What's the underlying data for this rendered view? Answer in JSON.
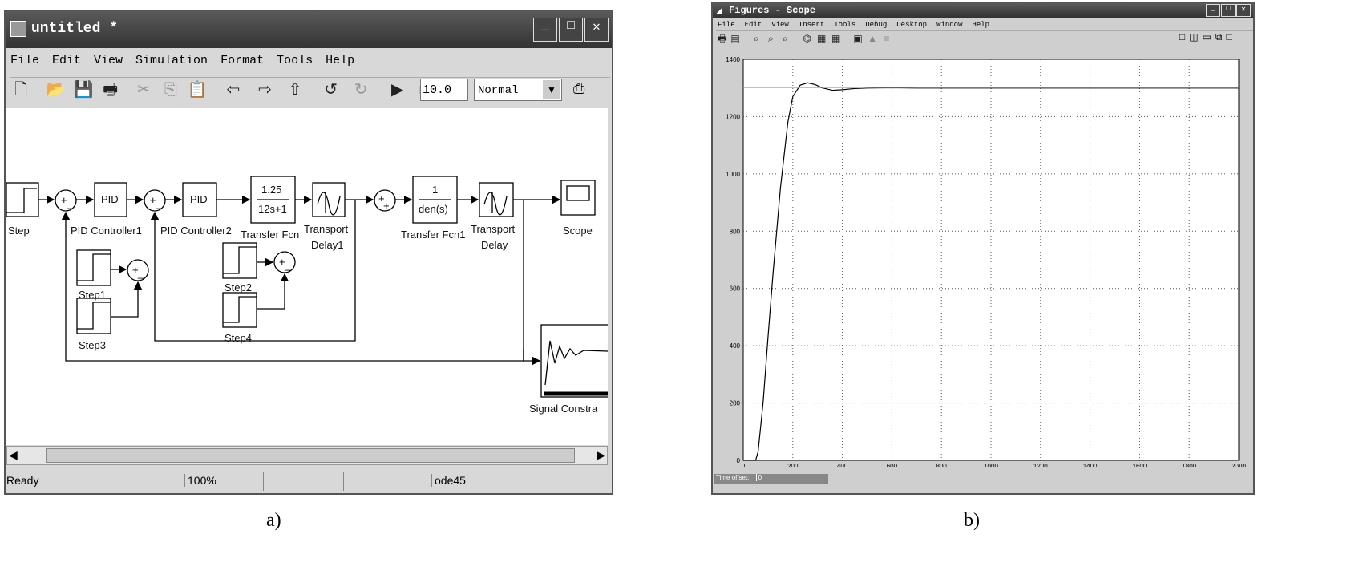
{
  "left_window": {
    "title": "untitled *",
    "menu": [
      "File",
      "Edit",
      "View",
      "Simulation",
      "Format",
      "Tools",
      "Help"
    ],
    "toolbar": {
      "icons": [
        "new-icon",
        "open-icon",
        "save-icon",
        "print-icon",
        "cut-icon",
        "copy-icon",
        "paste-icon",
        "back-icon",
        "forward-icon",
        "up-icon",
        "undo-icon",
        "redo-icon",
        "play-icon",
        "stop-icon"
      ],
      "stop_time": "10.0",
      "mode": "Normal"
    },
    "blocks": {
      "step": "Step",
      "pid1": "PID",
      "pid1_label": "PID Controller1",
      "pid2": "PID",
      "pid2_label": "PID Controller2",
      "tf_num": "1.25",
      "tf_den": "12s+1",
      "tf_label": "Transfer Fcn",
      "td1_label1": "Transport",
      "td1_label2": "Delay1",
      "tf1_num": "1",
      "tf1_den": "den(s)",
      "tf1_label": "Transfer Fcn1",
      "td_label1": "Transport",
      "td_label2": "Delay",
      "scope": "Scope",
      "step1": "Step1",
      "step2": "Step2",
      "step3": "Step3",
      "step4": "Step4",
      "signal": "Signal Constra"
    },
    "status": {
      "text": "Ready",
      "zoom": "100%",
      "solver": "ode45"
    }
  },
  "right_window": {
    "title": "Figures - Scope",
    "menu": [
      "File",
      "Edit",
      "View",
      "Insert",
      "Tools",
      "Debug",
      "Desktop",
      "Window",
      "Help"
    ],
    "time_offset_label": "Time offset:",
    "time_offset_value": "0"
  },
  "captions": {
    "a": "a)",
    "b": "b)"
  },
  "chart_data": {
    "type": "line",
    "title": "",
    "xlabel": "",
    "ylabel": "",
    "xlim": [
      0,
      2000
    ],
    "ylim": [
      0,
      1400
    ],
    "xticks": [
      0,
      200,
      400,
      600,
      800,
      1000,
      1200,
      1400,
      1600,
      1800,
      2000
    ],
    "yticks": [
      0,
      200,
      400,
      600,
      800,
      1000,
      1200,
      1400
    ],
    "grid": true,
    "series": [
      {
        "x": [
          0,
          50,
          60,
          80,
          100,
          120,
          150,
          180,
          200,
          230,
          260,
          290,
          320,
          360,
          400,
          450,
          500,
          600,
          700,
          800,
          1000,
          1500,
          2000
        ],
        "y": [
          0,
          0,
          30,
          200,
          430,
          650,
          950,
          1180,
          1270,
          1310,
          1318,
          1312,
          1300,
          1292,
          1294,
          1298,
          1300,
          1301,
          1300,
          1300,
          1300,
          1300,
          1300
        ]
      },
      {
        "x": [
          0,
          2000
        ],
        "y": [
          1300,
          1300
        ]
      }
    ]
  }
}
